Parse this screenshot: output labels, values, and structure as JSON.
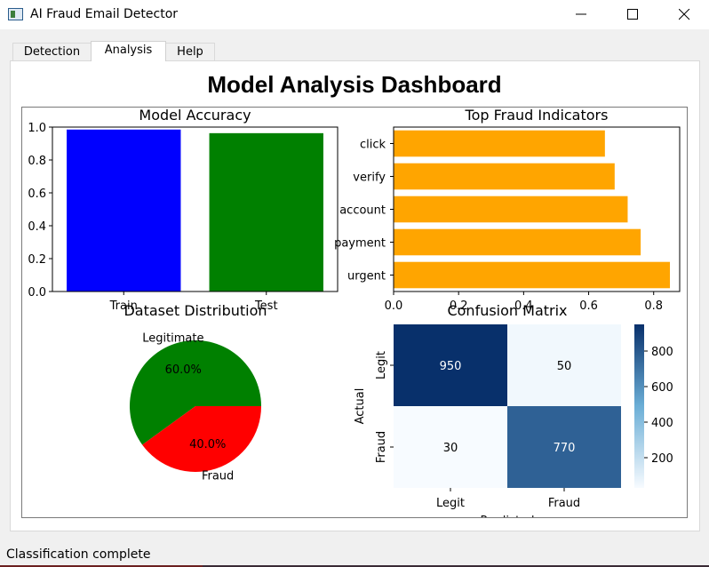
{
  "window": {
    "title": "AI Fraud Email Detector",
    "controls": [
      "minimize",
      "maximize",
      "close"
    ]
  },
  "tabs": [
    {
      "label": "Detection",
      "active": false
    },
    {
      "label": "Analysis",
      "active": true
    },
    {
      "label": "Help",
      "active": false
    }
  ],
  "dashboard": {
    "title": "Model Analysis Dashboard"
  },
  "status": {
    "text": "Classification complete"
  },
  "chart_data": [
    {
      "type": "bar",
      "title": "Model Accuracy",
      "categories": [
        "Train",
        "Test"
      ],
      "values": [
        0.985,
        0.963
      ],
      "colors": [
        "#0000ff",
        "#008000"
      ],
      "ylim": [
        0,
        1.0
      ],
      "yticks": [
        "0.0",
        "0.2",
        "0.4",
        "0.6",
        "0.8",
        "1.0"
      ]
    },
    {
      "type": "bar",
      "orientation": "horizontal",
      "title": "Top Fraud Indicators",
      "categories": [
        "urgent",
        "payment",
        "account",
        "verify",
        "click"
      ],
      "values": [
        0.85,
        0.76,
        0.72,
        0.68,
        0.65
      ],
      "color": "#ffa500",
      "xlim": [
        0,
        0.88
      ],
      "xticks": [
        "0.0",
        "0.2",
        "0.4",
        "0.6",
        "0.8"
      ]
    },
    {
      "type": "pie",
      "title": "Dataset Distribution",
      "labels": [
        "Legitimate",
        "Fraud"
      ],
      "values": [
        60.0,
        40.0
      ],
      "pct_labels": [
        "60.0%",
        "40.0%"
      ],
      "colors": [
        "#008000",
        "#ff0000"
      ]
    },
    {
      "type": "heatmap",
      "title": "Confusion Matrix",
      "xlabel": "Predicted",
      "ylabel": "Actual",
      "x_categories": [
        "Legit",
        "Fraud"
      ],
      "y_categories": [
        "Legit",
        "Fraud"
      ],
      "values": [
        [
          950,
          50
        ],
        [
          30,
          770
        ]
      ],
      "colorbar_ticks": [
        "200",
        "400",
        "600",
        "800"
      ],
      "colormap": "Blues"
    }
  ]
}
